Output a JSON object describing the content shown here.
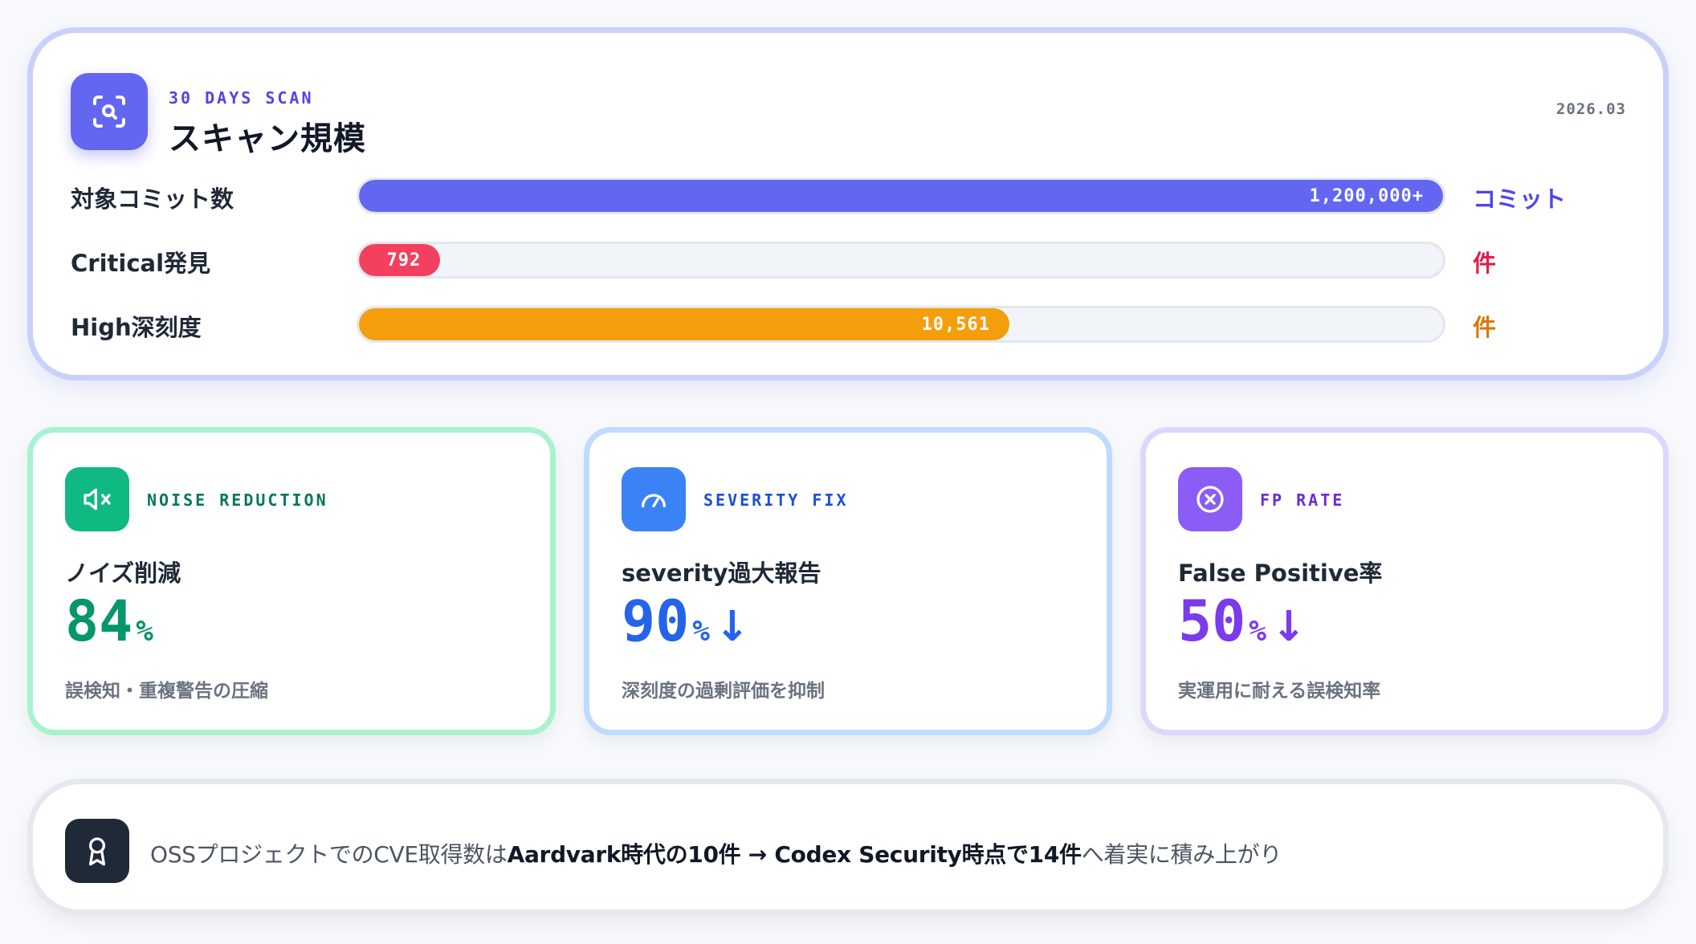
{
  "scan": {
    "kicker": "30 DAYS SCAN",
    "title": "スキャン規模",
    "date": "2026.03",
    "icon": "scan-search-icon",
    "rows": [
      {
        "label": "対象コミット数",
        "value_text": "1,200,000+",
        "unit": "コミット",
        "fraction": 1.0,
        "color": "#6366f1",
        "unit_color": "#4f46e5"
      },
      {
        "label": "Critical発見",
        "value_text": "792",
        "unit": "件",
        "fraction": 0.075,
        "color": "#f43f5e",
        "unit_color": "#e11d48"
      },
      {
        "label": "High深刻度",
        "value_text": "10,561",
        "unit": "件",
        "fraction": 0.6,
        "color": "#f59e0b",
        "unit_color": "#d97706"
      }
    ]
  },
  "metrics": [
    {
      "kicker": "NOISE REDUCTION",
      "title": "ノイズ削減",
      "value": "84",
      "unit": "%",
      "arrow": "",
      "description": "誤検知・重複警告の圧縮",
      "icon": "mute-speaker-icon",
      "accent": "#10b981",
      "text_color": "#059669",
      "kicker_color": "#047857",
      "border": "#a7f3d0"
    },
    {
      "kicker": "SEVERITY FIX",
      "title": "severity過大報告",
      "value": "90",
      "unit": "%",
      "arrow": "↓",
      "description": "深刻度の過剰評価を抑制",
      "icon": "gauge-icon",
      "accent": "#3b82f6",
      "text_color": "#2563eb",
      "kicker_color": "#1d4ed8",
      "border": "#bfdbfe"
    },
    {
      "kicker": "FP RATE",
      "title": "False Positive率",
      "value": "50",
      "unit": "%",
      "arrow": "↓",
      "description": "実運用に耐える誤検知率",
      "icon": "x-circle-icon",
      "accent": "#8b5cf6",
      "text_color": "#7c3aed",
      "kicker_color": "#6d28d9",
      "border": "#ddd6fe"
    }
  ],
  "note": {
    "icon": "award-icon",
    "prefix": "OSSプロジェクトでのCVE取得数は",
    "highlight1": "Aardvark時代の10件 → Codex Security時点で14件",
    "suffix": "へ着実に積み上がり"
  }
}
